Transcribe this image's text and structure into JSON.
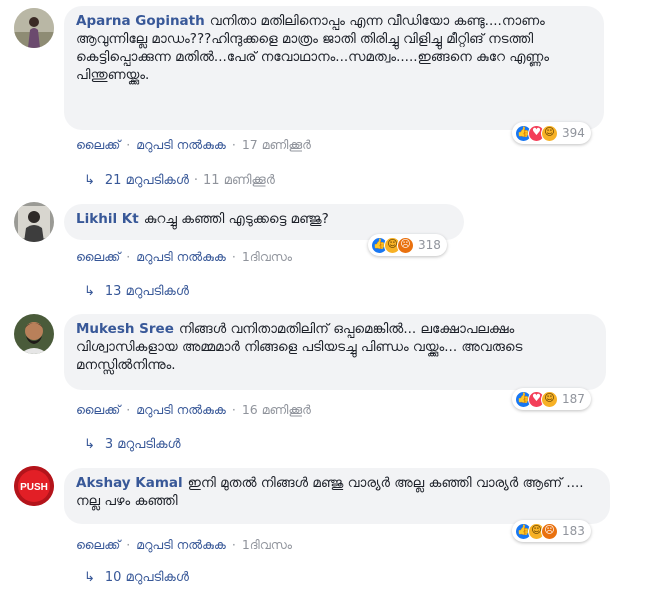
{
  "comments": [
    {
      "author": "Aparna Gopinath",
      "text": "വനിതാ മതിലിനൊപ്പം എന്ന വീഡിയോ കണ്ടു....നാണം ആവുന്നില്ലേ മാഡം???ഹിന്ദുക്കളെ മാത്രം ജാതി തിരിച്ചു വിളിച്ചു മീറ്റിങ് നടത്തി കെട്ടിപ്പൊക്കുന്ന മതിൽ...പേര് നവോഥാനം...സമത്വം.....ഇങ്ങനെ കുറേ എണ്ണം പിന്തുണയ്ക്കും.",
      "reaction_count": "394",
      "reactions": [
        "like",
        "love",
        "haha"
      ],
      "like_label": "ലൈക്ക്",
      "reply_label": "മറുപടി നൽകുക",
      "time": "17 മണിക്കൂർ",
      "replies_label": "21 മറുപടികൾ",
      "replies_time": "11 മണിക്കൂർ"
    },
    {
      "author": "Likhil Kt",
      "text": "കുറച്ചു കഞ്ഞി എടുക്കട്ടെ മഞ്ജു?",
      "reaction_count": "318",
      "reactions": [
        "like",
        "haha",
        "angry"
      ],
      "like_label": "ലൈക്ക്",
      "reply_label": "മറുപടി നൽകുക",
      "time": "1ദിവസം",
      "replies_label": "13 മറുപടികൾ"
    },
    {
      "author": "Mukesh Sree",
      "text": "നിങ്ങൾ വനിതാമതിലിന് ഒപ്പമെങ്കിൽ... ലക്ഷോപലക്ഷം വിശ്വാസികളായ അമ്മമാർ നിങ്ങളെ പടിയടച്ചു പിണ്ഡം വയ്ക്കും... അവരുടെ മനസ്സിൽനിന്നും.",
      "reaction_count": "187",
      "reactions": [
        "like",
        "love",
        "haha"
      ],
      "like_label": "ലൈക്ക്",
      "reply_label": "മറുപടി നൽകുക",
      "time": "16 മണിക്കൂർ",
      "replies_label": "3 മറുപടികൾ"
    },
    {
      "author": "Akshay Kamal",
      "text": "ഇനി മുതൽ നിങ്ങൾ മഞ്ജു വാര്യർ അല്ല കഞ്ഞി വാര്യർ ആണ് .... നല്ല പഴം കഞ്ഞി",
      "avatar_text": "PUSH",
      "reaction_count": "183",
      "reactions": [
        "like",
        "haha",
        "angry"
      ],
      "like_label": "ലൈക്ക്",
      "reply_label": "മറുപടി നൽകുക",
      "time": "1ദിവസം",
      "replies_label": "10 മറുപടികൾ"
    }
  ],
  "colors": {
    "author": "#385898",
    "bubble": "#f2f3f5",
    "meta": "#90949c",
    "like": "#1877f2",
    "love": "#f33e58",
    "haha": "#f7b125",
    "angry": "#e9710f"
  },
  "icons": {
    "like": "thumbs-up-icon",
    "love": "heart-icon",
    "haha": "laughing-face-icon",
    "angry": "angry-face-icon",
    "reply_arrow": "reply-arrow-icon"
  }
}
